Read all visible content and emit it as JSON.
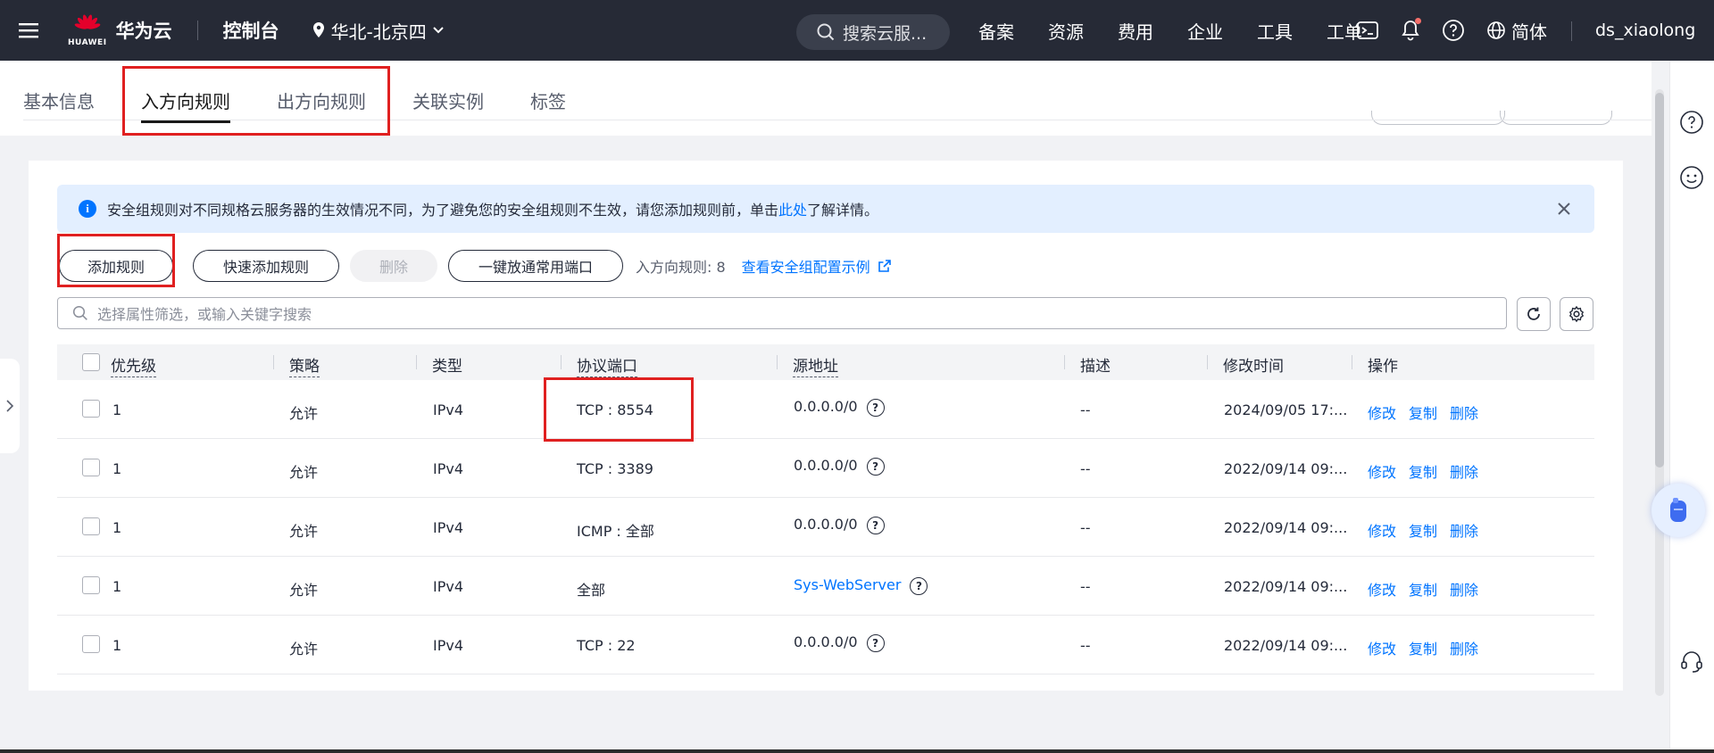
{
  "topbar": {
    "brand_small": "HUAWEI",
    "brand": "华为云",
    "console": "控制台",
    "region": "华北-北京四",
    "search_placeholder": "搜索云服...",
    "nav": [
      "备案",
      "资源",
      "费用",
      "企业",
      "工具",
      "工单"
    ],
    "language": "简体",
    "username": "ds_xiaolong"
  },
  "tabs": [
    "基本信息",
    "入方向规则",
    "出方向规则",
    "关联实例",
    "标签"
  ],
  "active_tab": "入方向规则",
  "notice": {
    "text_before": "安全组规则对不同规格云服务器的生效情况不同，为了避免您的安全组规则不生效，请您添加规则前，单击",
    "link": "此处",
    "text_after": "了解详情。"
  },
  "toolbar": {
    "add_rule": "添加规则",
    "quick_add": "快速添加规则",
    "delete": "删除",
    "open_ports": "一键放通常用端口",
    "rule_count": "入方向规则: 8",
    "example_link": "查看安全组配置示例"
  },
  "filter_placeholder": "选择属性筛选，或输入关键字搜索",
  "table": {
    "headers": {
      "priority": "优先级",
      "policy": "策略",
      "type": "类型",
      "port": "协议端口",
      "source": "源地址",
      "desc": "描述",
      "modified": "修改时间",
      "ops": "操作"
    },
    "rows": [
      {
        "priority": "1",
        "policy": "允许",
        "type": "IPv4",
        "port": "TCP : 8554",
        "source": "0.0.0.0/0",
        "desc": "--",
        "modified": "2024/09/05 17:...",
        "ops": [
          "修改",
          "复制",
          "删除"
        ]
      },
      {
        "priority": "1",
        "policy": "允许",
        "type": "IPv4",
        "port": "TCP : 3389",
        "source": "0.0.0.0/0",
        "desc": "--",
        "modified": "2022/09/14 09:...",
        "ops": [
          "修改",
          "复制",
          "删除"
        ]
      },
      {
        "priority": "1",
        "policy": "允许",
        "type": "IPv4",
        "port": "ICMP : 全部",
        "source": "0.0.0.0/0",
        "desc": "--",
        "modified": "2022/09/14 09:...",
        "ops": [
          "修改",
          "复制",
          "删除"
        ]
      },
      {
        "priority": "1",
        "policy": "允许",
        "type": "IPv4",
        "port": "全部",
        "source": "Sys-WebServer",
        "desc": "--",
        "modified": "2022/09/14 09:...",
        "ops": [
          "修改",
          "复制",
          "删除"
        ]
      },
      {
        "priority": "1",
        "policy": "允许",
        "type": "IPv4",
        "port": "TCP : 22",
        "source": "0.0.0.0/0",
        "desc": "--",
        "modified": "2022/09/14 09:...",
        "ops": [
          "修改",
          "复制",
          "删除"
        ]
      }
    ]
  },
  "colors": {
    "topbar": "#262a36",
    "link": "#0074ff",
    "highlight": "#e02020",
    "notice_bg": "#e3efff"
  }
}
